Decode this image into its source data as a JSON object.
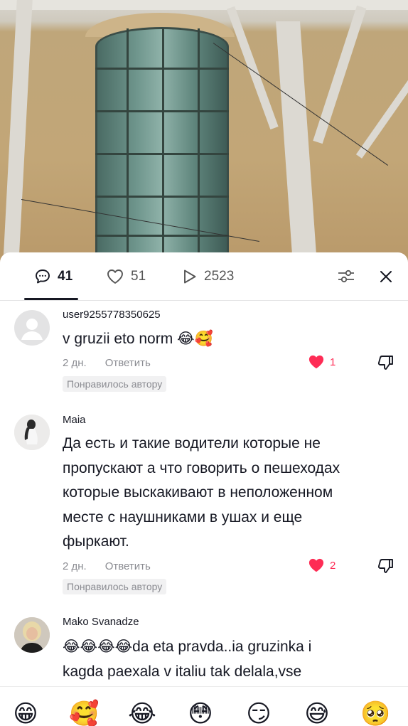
{
  "tabs": {
    "comments_count": "41",
    "likes_count": "51",
    "views_count": "2523"
  },
  "icons": {
    "comment": "comment-icon",
    "like": "heart-outline-icon",
    "views": "play-icon",
    "filter": "filter-sliders-icon",
    "close": "close-icon"
  },
  "colors": {
    "accent": "#fe2c55",
    "text": "#161823",
    "secondary": "#8a8b91"
  },
  "comments": [
    {
      "username": "user9255778350625",
      "text_lines": [
        "v gruzii eto norm 😂🥰"
      ],
      "time": "2 дн.",
      "reply_label": "Ответить",
      "likes": "1",
      "liked_by_author": "Понравилось автору"
    },
    {
      "username": "Maia",
      "text_lines": [
        "Да есть и такие водители которые не",
        "пропускают а что говорить о пешеходах",
        "которые выскакивают в неположенном",
        "месте с наушниками в ушах и еще",
        "фыркают."
      ],
      "time": "2 дн.",
      "reply_label": "Ответить",
      "likes": "2",
      "liked_by_author": "Понравилось автору"
    },
    {
      "username": "Mako Svanadze",
      "text_lines": [
        "😂😂😂😂da eta pravda..ia gruzinka i",
        "kagda paexala v italiu tak delala,vse"
      ]
    }
  ],
  "emoji_bar": [
    "😁",
    "🥰",
    "😂",
    "😳",
    "😏",
    "😅",
    "🥺"
  ]
}
